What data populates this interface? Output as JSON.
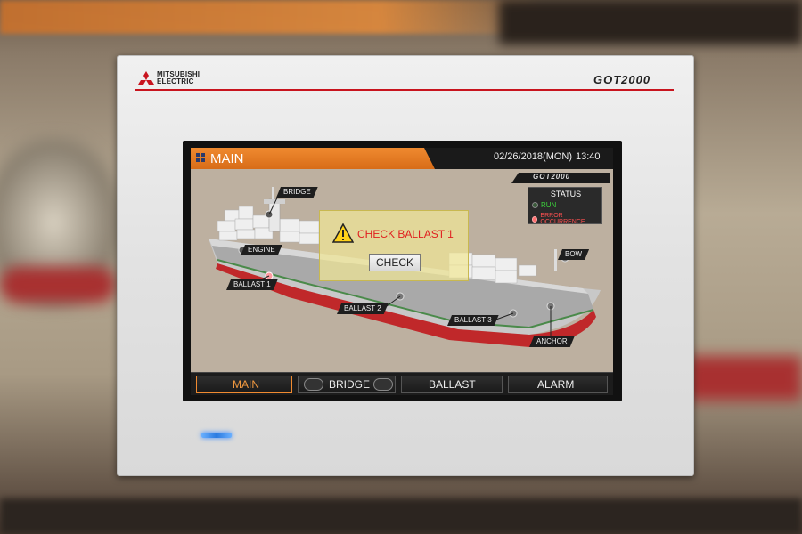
{
  "device": {
    "brand_line1": "MITSUBISHI",
    "brand_line2": "ELECTRIC",
    "model": "GOT2000"
  },
  "screen": {
    "title": "MAIN",
    "date": "02/26/2018(MON)",
    "time": "13:40",
    "sublogo": "GOT2000"
  },
  "status_panel": {
    "title": "STATUS",
    "run_label": "RUN",
    "error_label": "ERROR OCCURRENCE",
    "run_color": "#3cd23c",
    "error_color": "#ff5050"
  },
  "ship_tags": {
    "bridge": "BRIDGE",
    "engine": "ENGINE",
    "ballast1": "BALLAST 1",
    "ballast2": "BALLAST 2",
    "ballast3": "BALLAST 3",
    "bow": "BOW",
    "anchor": "ANCHOR"
  },
  "popup": {
    "message": "CHECK BALLAST 1",
    "button": "CHECK"
  },
  "nav": {
    "items": [
      {
        "label": "MAIN",
        "active": true
      },
      {
        "label": "BRIDGE",
        "active": false
      },
      {
        "label": "BALLAST",
        "active": false
      },
      {
        "label": "ALARM",
        "active": false
      }
    ]
  },
  "colors": {
    "accent": "#f08a30",
    "brand_red": "#c8141e",
    "hull_red": "#c0282a"
  }
}
